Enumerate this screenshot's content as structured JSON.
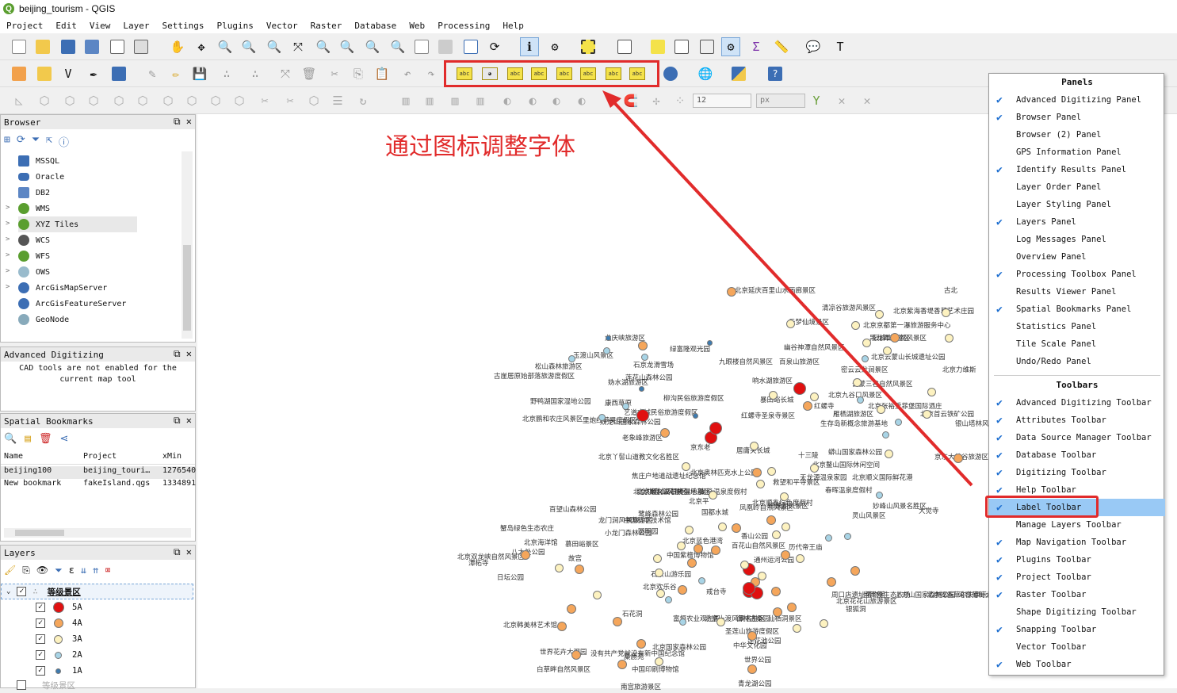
{
  "window": {
    "title": "beijing_tourism - QGIS",
    "logo": "Q"
  },
  "menu": [
    "Project",
    "Edit",
    "View",
    "Layer",
    "Settings",
    "Plugins",
    "Vector",
    "Raster",
    "Database",
    "Web",
    "Processing",
    "Help"
  ],
  "annotation": {
    "text": "通过图标调整字体",
    "color": "#e12b2b"
  },
  "label_icons": [
    "abc",
    "abc",
    "abc",
    "abc",
    "abc",
    "abc",
    "abc",
    "abc"
  ],
  "snapping": {
    "tolerance": "12",
    "units": "px"
  },
  "browser": {
    "title": "Browser",
    "items": [
      "MSSQL",
      "Oracle",
      "DB2",
      "WMS",
      "XYZ Tiles",
      "WCS",
      "WFS",
      "OWS",
      "ArcGisMapServer",
      "ArcGisFeatureServer",
      "GeoNode"
    ],
    "expand_marker": ">"
  },
  "advanced_digitizing": {
    "title": "Advanced Digitizing",
    "message_line1": "CAD tools are not enabled for the",
    "message_line2": "current map tool"
  },
  "bookmarks": {
    "title": "Spatial Bookmarks",
    "columns": [
      "Name",
      "Project",
      "xMin"
    ],
    "rows": [
      [
        "beijing100",
        "beijing_touri…",
        "1276540"
      ],
      [
        "New bookmark",
        "fakeIsland.qgs",
        "1334891"
      ]
    ]
  },
  "layers": {
    "title": "Layers",
    "group": "等级景区",
    "classes": [
      {
        "label": "5A",
        "color": "#e01010"
      },
      {
        "label": "4A",
        "color": "#f5a65b"
      },
      {
        "label": "3A",
        "color": "#fdf2c0"
      },
      {
        "label": "2A",
        "color": "#a8d4e6"
      },
      {
        "label": "1A",
        "color": "#3d7bb0"
      }
    ],
    "second_group": "等级景区"
  },
  "panels_menu": {
    "panels_heading": "Panels",
    "panels": [
      {
        "label": "Advanced Digitizing Panel",
        "checked": true
      },
      {
        "label": "Browser Panel",
        "checked": true
      },
      {
        "label": "Browser (2) Panel",
        "checked": false
      },
      {
        "label": "GPS Information Panel",
        "checked": false
      },
      {
        "label": "Identify Results Panel",
        "checked": true
      },
      {
        "label": "Layer Order Panel",
        "checked": false
      },
      {
        "label": "Layer Styling Panel",
        "checked": false
      },
      {
        "label": "Layers Panel",
        "checked": true
      },
      {
        "label": "Log Messages Panel",
        "checked": false
      },
      {
        "label": "Overview Panel",
        "checked": false
      },
      {
        "label": "Processing Toolbox Panel",
        "checked": true
      },
      {
        "label": "Results Viewer Panel",
        "checked": false
      },
      {
        "label": "Spatial Bookmarks Panel",
        "checked": true
      },
      {
        "label": "Statistics Panel",
        "checked": false
      },
      {
        "label": "Tile Scale Panel",
        "checked": false
      },
      {
        "label": "Undo/Redo Panel",
        "checked": false
      }
    ],
    "toolbars_heading": "Toolbars",
    "toolbars": [
      {
        "label": "Advanced Digitizing Toolbar",
        "checked": true
      },
      {
        "label": "Attributes Toolbar",
        "checked": true
      },
      {
        "label": "Data Source Manager Toolbar",
        "checked": true
      },
      {
        "label": "Database Toolbar",
        "checked": true
      },
      {
        "label": "Digitizing Toolbar",
        "checked": true
      },
      {
        "label": "Help Toolbar",
        "checked": true
      },
      {
        "label": "Label Toolbar",
        "checked": true,
        "highlighted": true
      },
      {
        "label": "Manage Layers Toolbar",
        "checked": false
      },
      {
        "label": "Map Navigation Toolbar",
        "checked": true
      },
      {
        "label": "Plugins Toolbar",
        "checked": true
      },
      {
        "label": "Project Toolbar",
        "checked": true
      },
      {
        "label": "Raster Toolbar",
        "checked": true
      },
      {
        "label": "Shape Digitizing Toolbar",
        "checked": false
      },
      {
        "label": "Snapping Toolbar",
        "checked": true
      },
      {
        "label": "Vector Toolbar",
        "checked": false
      },
      {
        "label": "Web Toolbar",
        "checked": true
      }
    ]
  },
  "map_labels": [
    "北京延庆百里山水画廊景区",
    "古北",
    "清凉谷旅游风景区",
    "北京紫海香堤香草艺术庄园",
    "云梦仙境景区",
    "北京京都第一瀑旅游服务中心",
    "黑龙潭旅游区",
    "云峰山自然风景区",
    "龙庆峡旅游区",
    "绿富隆观光园",
    "幽谷神潭自然风景区",
    "玉渡山风景区",
    "九眼楼自然风景区",
    "百泉山旅游区",
    "北京云蒙山长城遗址公园",
    "松山森林旅游区",
    "石京龙滑雪场",
    "密云云龙涧景区",
    "北京力维斯",
    "古崖居原始部落旅游度假区",
    "妫水湖旅游区",
    "莲花山森林公园",
    "响水湖旅游区",
    "云蒙三谷自然风景区",
    "北京九谷口风景区",
    "暴田峪长城",
    "红螺寺",
    "北京张裕爱菲堡国际酒庄",
    "野鸭湖国家湿地公园",
    "康西草原",
    "柳沟民俗旅游度假区",
    "雁栖湖旅游区",
    "北京首云铁矿公园",
    "艺道古城民俗旅游度假区",
    "红螺寺圣泉寺景区",
    "生存岛新概念旅游基地",
    "里炮红苹果度假区",
    "双龙山国家森林公园",
    "银山塔林风景区",
    "北京鹏和农庄风景区",
    "老象峰旅游区",
    "京东老",
    "居庸关长城",
    "十三陵",
    "蟒山国家森林公园",
    "北京丫髻山道教文化名胜区",
    "北京鳌山国际休闲空间",
    "焦庄户地道战遗址纪念馆",
    "京东大峡谷旅游区",
    "天龙源温泉家园",
    "北京奥林匹克水上公园",
    "救望和平寺景区",
    "北京顺义国际鲜花港",
    "北京棋盘山风景区",
    "龙脉温泉度假村",
    "春晖温泉度假村",
    "北京乡村高尔夫俱乐部",
    "北京顺义汉石桥湿地景区",
    "北京平",
    "凤凰岭自然风景区",
    "珍珠湖风景区",
    "妙峰山风景名胜区",
    "鹭峰森林公园",
    "国都水城",
    "北京顺鑫绿色度假村",
    "灵山风景区",
    "百望山森林公园",
    "龙门涧风景旅游区",
    "中国科学技术馆",
    "大觉寺",
    "蟹岛绿色生态农庄",
    "小龙门森林公园",
    "圆明园",
    "香山公园",
    "北京双龙峡自然风景区",
    "北京海洋馆",
    "北京蓝色港湾",
    "慕田峪景区",
    "八大处公园",
    "故宫",
    "中国紫檀博物馆",
    "百花山自然风景区",
    "潭柘寺",
    "石景山游乐园",
    "历代帝王庙",
    "通州运河公园",
    "日坛公园",
    "北京欢乐谷",
    "戒台寺",
    "北京花花山旅游景区",
    "圣莲山旅游度假区",
    "莲花池公园",
    "北京韩美林艺术馆",
    "银狐洞",
    "北京国家森林公园",
    "世界花卉大观园",
    "没有共产党就没有新中国纪念馆",
    "世界公园",
    "白草畔自然风景区",
    "中华文化园",
    "麋鹿苑",
    "石花洞",
    "青龙湖公园",
    "南宫旅游景区",
    "中国印刷博物馆",
    "周口店遗址博物馆",
    "留民营生态农场",
    "上方山国家森林公园",
    "北京提香草尔夫俱乐部",
    "采育葡萄大世界观光葡园",
    "富恒农业观光园",
    "北京十渡风景名胜区",
    "御林古桑园",
    "仙栖洞景区"
  ]
}
